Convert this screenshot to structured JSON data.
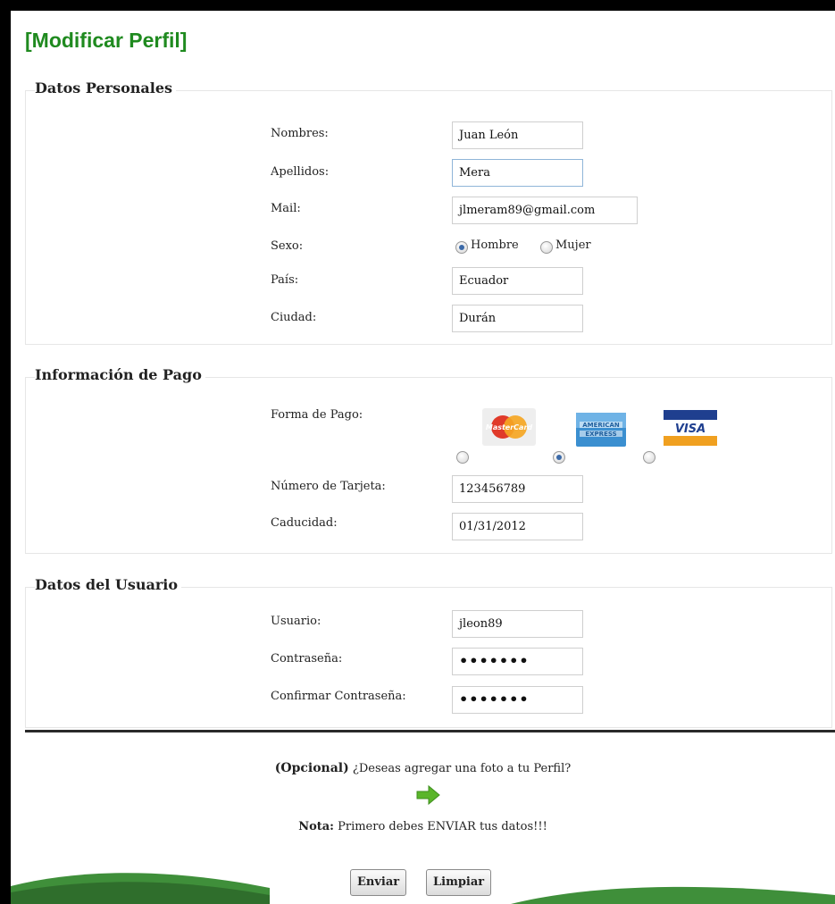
{
  "page": {
    "title": "[Modificar Perfil]"
  },
  "personal": {
    "legend": "Datos Personales",
    "nombres_label": "Nombres:",
    "nombres_value": "Juan León",
    "apellidos_label": "Apellidos:",
    "apellidos_value": "Mera",
    "mail_label": "Mail:",
    "mail_value": "jlmeram89@gmail.com",
    "sexo_label": "Sexo:",
    "sexo_options": [
      "Hombre",
      "Mujer"
    ],
    "sexo_selected": "Hombre",
    "pais_label": "País:",
    "pais_value": "Ecuador",
    "ciudad_label": "Ciudad:",
    "ciudad_value": "Durán"
  },
  "pago": {
    "legend": "Información de Pago",
    "forma_label": "Forma de Pago:",
    "cards": [
      "MasterCard",
      "American Express",
      "VISA"
    ],
    "card_icons": [
      "mastercard-icon",
      "amex-icon",
      "visa-icon"
    ],
    "selected_card": "American Express",
    "numero_label": "Número de Tarjeta:",
    "numero_value": "123456789",
    "caducidad_label": "Caducidad:",
    "caducidad_value": "01/31/2012"
  },
  "usuario": {
    "legend": "Datos del Usuario",
    "usuario_label": "Usuario:",
    "usuario_value": "jleon89",
    "password_label": "Contraseña:",
    "password_value": "•••••••",
    "confirm_label": "Confirmar Contraseña:",
    "confirm_value": "•••••••"
  },
  "footer": {
    "opcional_bold": "(Opcional)",
    "opcional_text": " ¿Deseas agregar una foto a tu Perfil?",
    "arrow_icon": "arrow-right-icon",
    "nota_bold": "Nota:",
    "nota_text": " Primero debes ENVIAR tus datos!!!",
    "enviar_label": "Enviar",
    "limpiar_label": "Limpiar"
  },
  "colors": {
    "title_green": "#1f8a1f",
    "arrow_green": "#5ab52a",
    "swoosh_green": "#3f8f3a"
  }
}
